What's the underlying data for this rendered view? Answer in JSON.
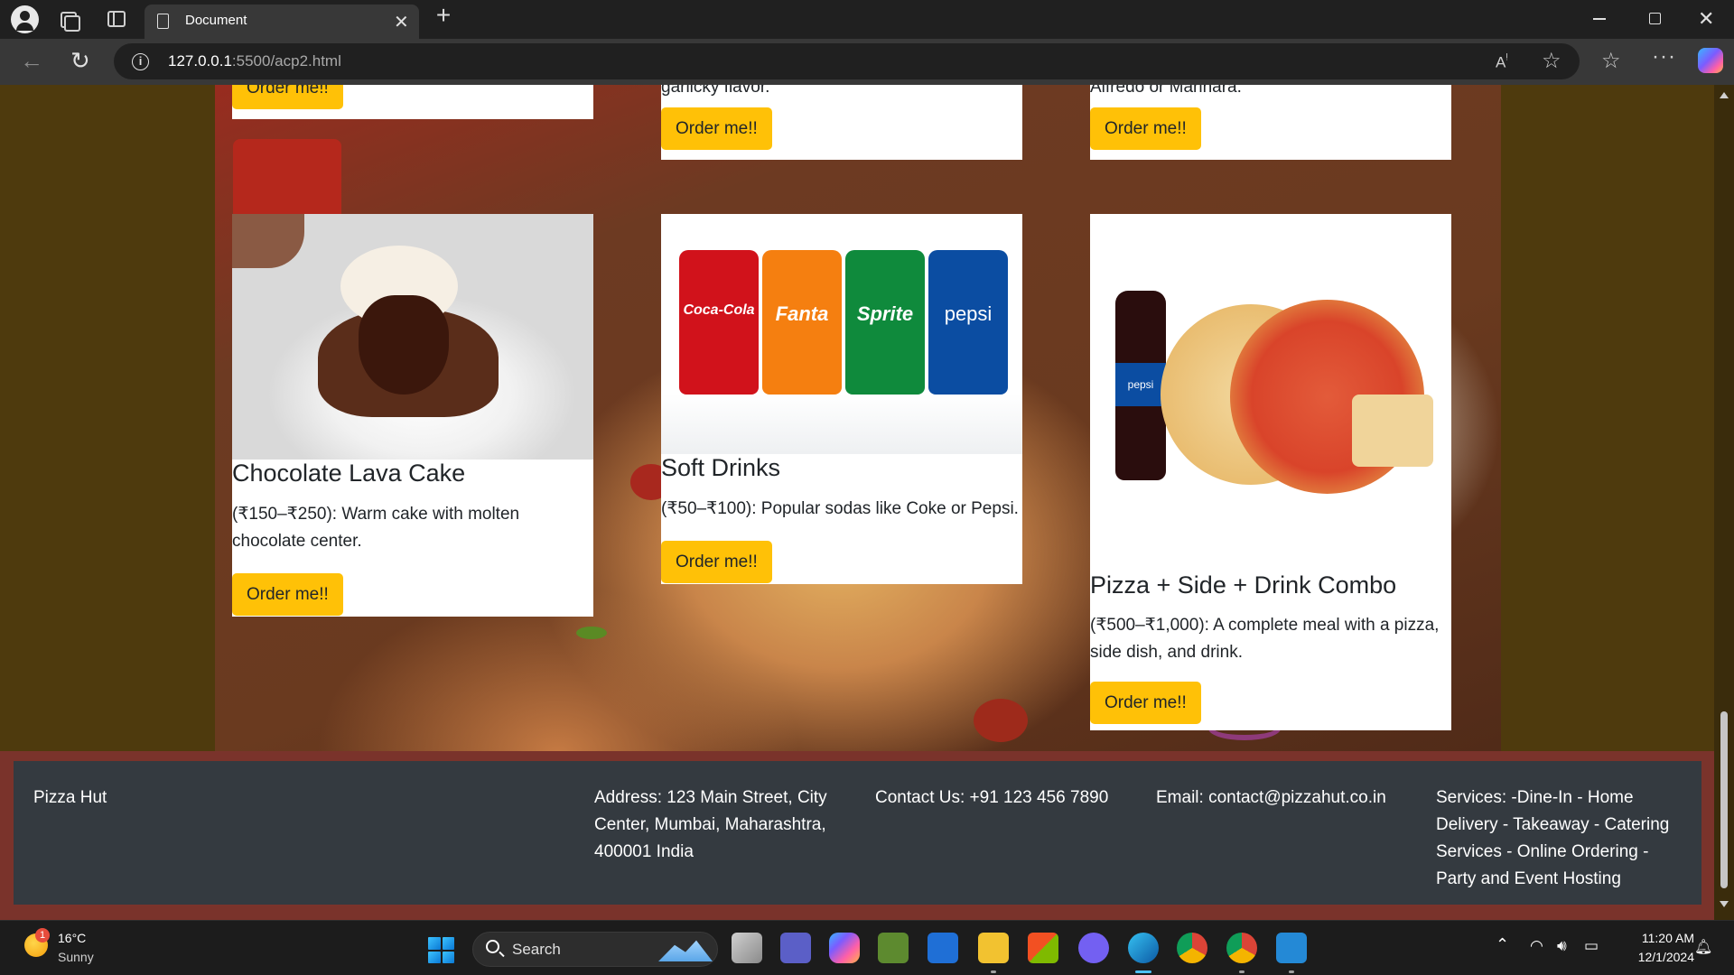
{
  "browser": {
    "tab_title": "Document",
    "url_host": "127.0.0.1",
    "url_path": ":5500/acp2.html"
  },
  "menu": {
    "top_cards": [
      {
        "cut_text": "",
        "button": "Order me!!"
      },
      {
        "cut_text": "garlicky flavor.",
        "button": "Order me!!"
      },
      {
        "cut_text": "Alfredo or Marinara.",
        "button": "Order me!!"
      }
    ],
    "cards": [
      {
        "title": "Chocolate Lava Cake",
        "description": "(₹150–₹250): Warm cake with molten chocolate center.",
        "button": "Order me!!"
      },
      {
        "title": "Soft Drinks",
        "description": "(₹50–₹100): Popular sodas like Coke or Pepsi.",
        "button": "Order me!!",
        "cans": [
          {
            "label": "Coca-Cola",
            "color": "#d1121b"
          },
          {
            "label": "Fanta",
            "color": "#f57f10"
          },
          {
            "label": "Sprite",
            "color": "#0f8a3c"
          },
          {
            "label": "pepsi",
            "color": "#0b4da2"
          }
        ]
      },
      {
        "title": "Pizza + Side + Drink Combo",
        "description": "(₹500–₹1,000): A complete meal with a pizza, side dish, and drink.",
        "button": "Order me!!",
        "bottle_label": "pepsi"
      }
    ]
  },
  "footer": {
    "brand": "Pizza Hut",
    "address": "Address: 123 Main Street, City Center, Mumbai, Maharashtra, 400001 India",
    "contact": "Contact Us: +91 123 456 7890",
    "email": "Email: contact@pizzahut.co.in",
    "services": "Services: -Dine-In - Home Delivery - Takeaway - Catering Services - Online Ordering - Party and Event Hosting"
  },
  "taskbar": {
    "weather_temp": "16°C",
    "weather_condition": "Sunny",
    "weather_badge": "1",
    "search_label": "Search",
    "time": "11:20 AM",
    "date": "12/1/2024"
  },
  "colors": {
    "page_bg": "#4e3a0d",
    "button": "#ffc107",
    "footer_bg": "#343a40",
    "footer_border": "#7a332b"
  }
}
